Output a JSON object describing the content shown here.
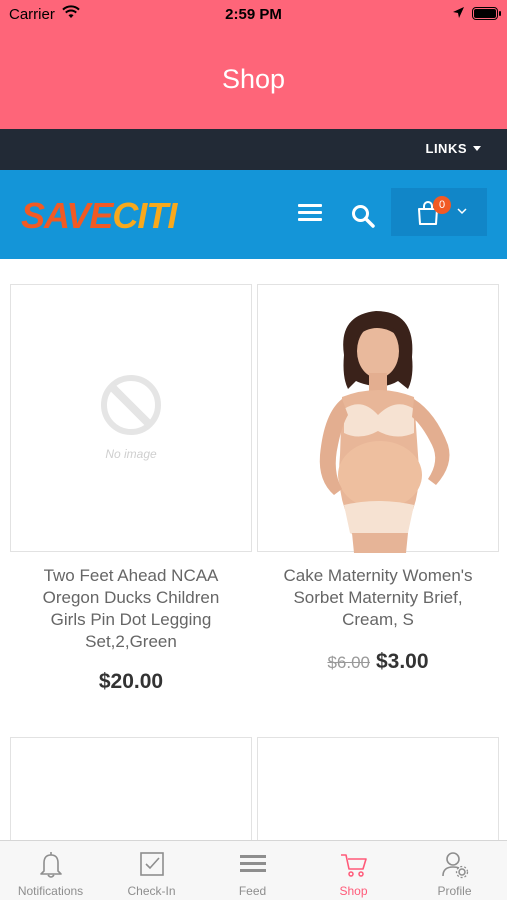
{
  "status_bar": {
    "carrier": "Carrier",
    "time": "2:59 PM"
  },
  "header": {
    "title": "Shop"
  },
  "links_bar": {
    "label": "LINKS"
  },
  "store_header": {
    "logo_part1": "SAVE",
    "logo_part2": "CITI",
    "cart_count": "0",
    "colors": {
      "header_bg": "#1495d8",
      "logo_orange": "#f15a24",
      "logo_yellow": "#f8a91c"
    }
  },
  "products": [
    {
      "name_lines": [
        "Two Feet Ahead NCAA",
        "Oregon Ducks Children",
        "Girls Pin Dot Legging",
        "Set,2,Green"
      ],
      "image_placeholder": "No image",
      "price": "$20.00"
    },
    {
      "name_lines": [
        "Cake Maternity Women's",
        "Sorbet Maternity Brief,",
        "Cream, S"
      ],
      "old_price": "$6.00",
      "price": "$3.00"
    }
  ],
  "tab_bar": {
    "tabs": [
      {
        "label": "Notifications",
        "icon": "bell-icon"
      },
      {
        "label": "Check-In",
        "icon": "checkbox-icon"
      },
      {
        "label": "Feed",
        "icon": "feed-lines-icon"
      },
      {
        "label": "Shop",
        "icon": "cart-icon",
        "active": true
      },
      {
        "label": "Profile",
        "icon": "profile-gear-icon"
      }
    ],
    "active_color": "#ff5a79"
  },
  "colors": {
    "top_bar": "#fe6579",
    "links_bar": "#222a36"
  }
}
